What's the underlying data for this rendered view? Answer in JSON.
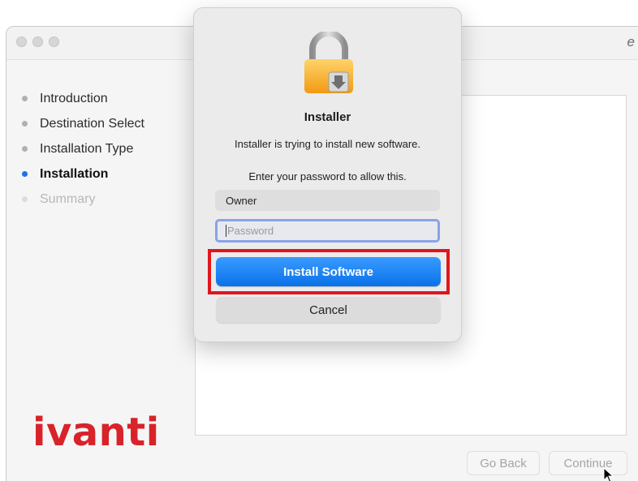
{
  "window": {
    "title_fragment": "e",
    "steps": [
      {
        "label": "Introduction",
        "state": "done"
      },
      {
        "label": "Destination Select",
        "state": "done"
      },
      {
        "label": "Installation Type",
        "state": "done"
      },
      {
        "label": "Installation",
        "state": "active"
      },
      {
        "label": "Summary",
        "state": "pending"
      }
    ],
    "logo_text": "ivanti",
    "go_back_label": "Go Back",
    "continue_label": "Continue",
    "colors": {
      "logo": "#d8232a",
      "active_dot": "#1a73e8"
    }
  },
  "dialog": {
    "icon": "lock-icon",
    "title": "Installer",
    "message": "Installer is trying to install new software.",
    "prompt": "Enter your password to allow this.",
    "username": "Owner",
    "password_placeholder": "Password",
    "install_button": "Install Software",
    "cancel_button": "Cancel",
    "colors": {
      "primary_button": "#0a72e8",
      "highlight": "#e0161e"
    }
  }
}
